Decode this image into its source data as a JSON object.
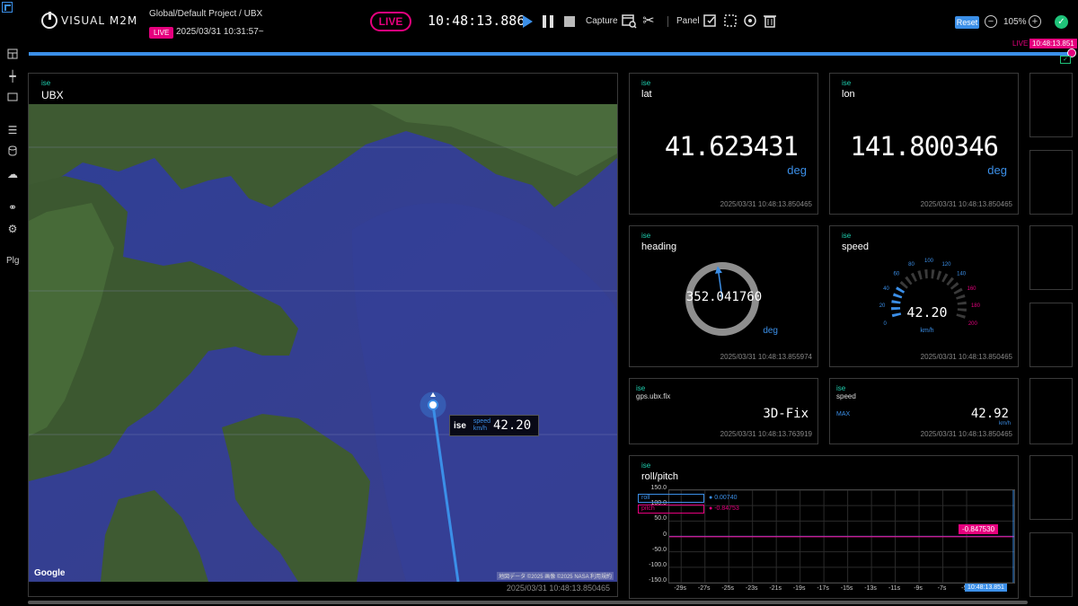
{
  "app": {
    "logo_text": "VISUAL M2M",
    "project_path": "Global/Default Project / UBX",
    "live_badge": "LIVE",
    "start_time": "2025/03/31 10:31:57~"
  },
  "toolbar": {
    "live_label": "LIVE",
    "clock": "10:48:13.886",
    "capture_label": "Capture",
    "panel_label": "Panel",
    "reset_label": "Reset",
    "zoom_minus": "−",
    "zoom_plus": "+",
    "zoom_value": "105%",
    "status_check": "✓"
  },
  "timeline": {
    "live_label": "LIVE",
    "current_time": "10:48:13.851"
  },
  "sidebar": {
    "plg_label": "Plg"
  },
  "map_panel": {
    "tag": "ise",
    "title": "UBX",
    "google_label": "Google",
    "attribution": "地図データ ©2025 画像 ©2025 NASA  利用規約",
    "timestamp": "2025/03/31 10:48:13.850465",
    "vehicle": {
      "name": "ise",
      "unit_line1": "speed",
      "unit_line2": "km/h",
      "speed": "42.20"
    }
  },
  "widgets": {
    "lat": {
      "tag": "ise",
      "title": "lat",
      "value": "41.623431",
      "unit": "deg",
      "timestamp": "2025/03/31 10:48:13.850465"
    },
    "lon": {
      "tag": "ise",
      "title": "lon",
      "value": "141.800346",
      "unit": "deg",
      "timestamp": "2025/03/31 10:48:13.850465"
    },
    "heading": {
      "tag": "ise",
      "title": "heading",
      "value": "352.041760",
      "unit": "deg",
      "timestamp": "2025/03/31 10:48:13.855974"
    },
    "speed_gauge": {
      "tag": "ise",
      "title": "speed",
      "value": "42.20",
      "unit": "km/h",
      "timestamp": "2025/03/31 10:48:13.850465",
      "scale_labels": [
        "0",
        "20",
        "40",
        "60",
        "80",
        "100",
        "120",
        "140",
        "160",
        "180",
        "200"
      ],
      "gauge_level": 0.211
    },
    "gps_fix": {
      "tag": "ise",
      "title": "gps.ubx.fix",
      "value": "3D-Fix",
      "timestamp": "2025/03/31 10:48:13.763919"
    },
    "speed_max": {
      "tag": "ise",
      "title": "speed",
      "max_label": "MAX",
      "value": "42.92",
      "unit": "km/h",
      "timestamp": "2025/03/31 10:48:13.850465"
    },
    "roll_pitch": {
      "tag": "ise",
      "title": "roll/pitch",
      "legend": [
        {
          "name": "roll",
          "value": "0.00740",
          "color": "#3b8fe8"
        },
        {
          "name": "pitch",
          "value": "-0.84753",
          "color": "#e6007e"
        }
      ],
      "pitch_tag": "-0.847530",
      "time_tag": "10:48:13.851"
    }
  },
  "colors": {
    "accent": "#3b8fe8",
    "live": "#e6007e",
    "ok": "#1fc47a",
    "tag": "#1fd0b0"
  },
  "chart_data": {
    "type": "line",
    "title": "roll/pitch",
    "x_ticks": [
      "-29s",
      "-27s",
      "-25s",
      "-23s",
      "-21s",
      "-19s",
      "-17s",
      "-15s",
      "-13s",
      "-11s",
      "-9s",
      "-7s",
      "-5s"
    ],
    "y_ticks": [
      "150.0",
      "100.0",
      "50.0",
      "0",
      "-50.0",
      "-100.0",
      "-150.0"
    ],
    "ylim": [
      -150,
      150
    ],
    "grid": true,
    "legend_position": "top-left",
    "series": [
      {
        "name": "roll",
        "x": [
          -30,
          -1
        ],
        "values": [
          0.0074,
          0.0074
        ]
      },
      {
        "name": "pitch",
        "x": [
          -30,
          -1
        ],
        "values": [
          -0.84753,
          -0.84753
        ]
      }
    ]
  }
}
